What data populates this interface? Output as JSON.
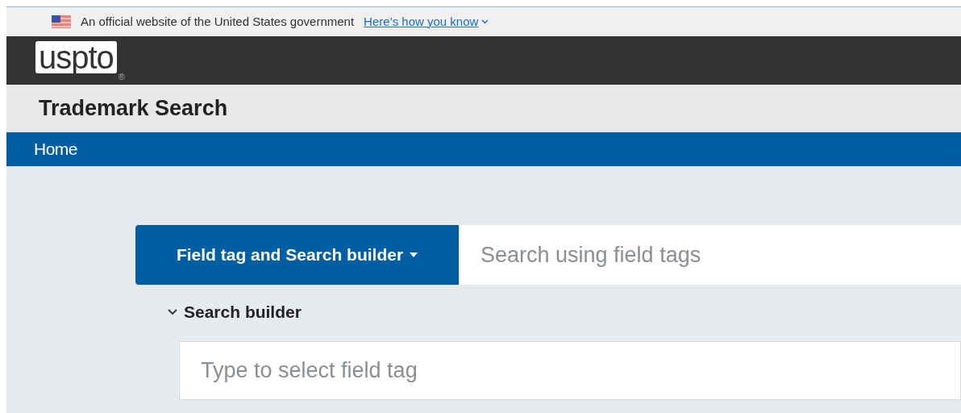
{
  "gov_banner": {
    "text": "An official website of the United States government",
    "link": "Here’s how you know",
    "expanded": false
  },
  "logo": {
    "text": "uspto",
    "mark": "®"
  },
  "title": "Trademark Search",
  "nav": [
    {
      "label": "Home"
    }
  ],
  "search": {
    "mode_button": "Field tag and Search builder",
    "placeholder": "Search using field tags"
  },
  "search_builder": {
    "label": "Search builder",
    "expanded": true,
    "field_placeholder": "Type to select field tag"
  }
}
